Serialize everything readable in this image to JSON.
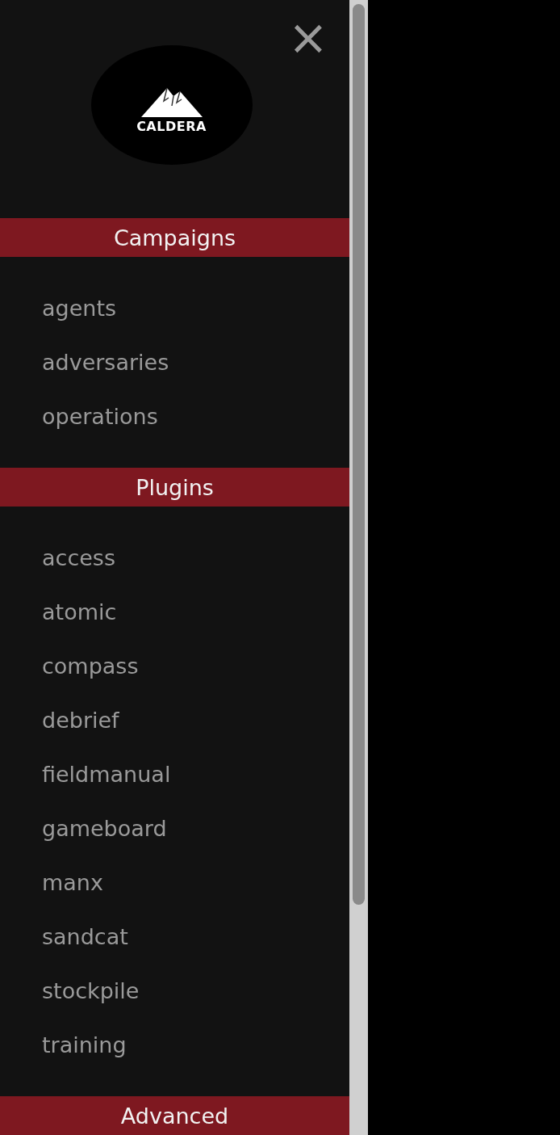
{
  "logo": {
    "text": "CALDERA"
  },
  "close": {
    "symbol": "×"
  },
  "sections": [
    {
      "title": "Campaigns",
      "items": [
        "agents",
        "adversaries",
        "operations"
      ]
    },
    {
      "title": "Plugins",
      "items": [
        "access",
        "atomic",
        "compass",
        "debrief",
        "fieldmanual",
        "gameboard",
        "manx",
        "sandcat",
        "stockpile",
        "training"
      ]
    },
    {
      "title": "Advanced"
    }
  ]
}
